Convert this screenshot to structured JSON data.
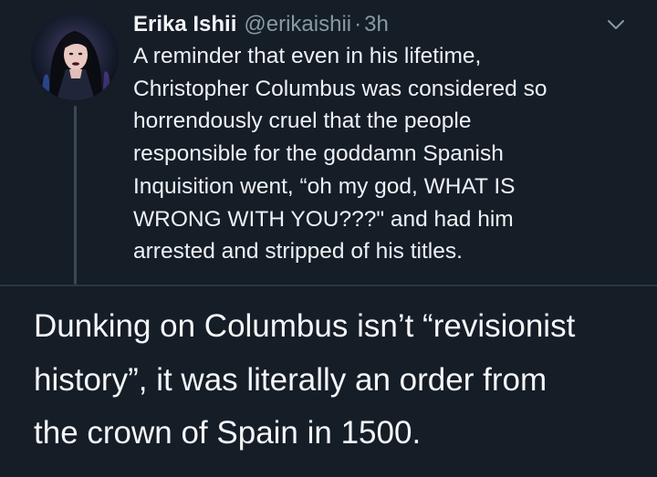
{
  "tweet": {
    "author_name": "Erika Ishii",
    "author_handle": "@erikaishii",
    "separator": "·",
    "timestamp": "3h",
    "avatar_icon": "profile-photo",
    "menu_icon": "chevron-down-icon",
    "text_lines": [
      "A reminder that even in his lifetime,",
      "Christopher Columbus was considered so",
      "horrendously cruel that the people",
      "responsible for the goddamn Spanish",
      "Inquisition went, “oh my god, WHAT IS",
      "WRONG WITH YOU???\" and had him",
      "arrested and stripped of his titles."
    ]
  },
  "caption": {
    "lines": [
      "Dunking on Columbus isn’t “revisionist",
      "history”, it was literally an order from",
      "the crown of Spain in 1500."
    ]
  },
  "colors": {
    "background": "#151d27",
    "secondary_text": "#8899a6",
    "primary_text": "#eef1f4",
    "divider": "#2c3640"
  }
}
